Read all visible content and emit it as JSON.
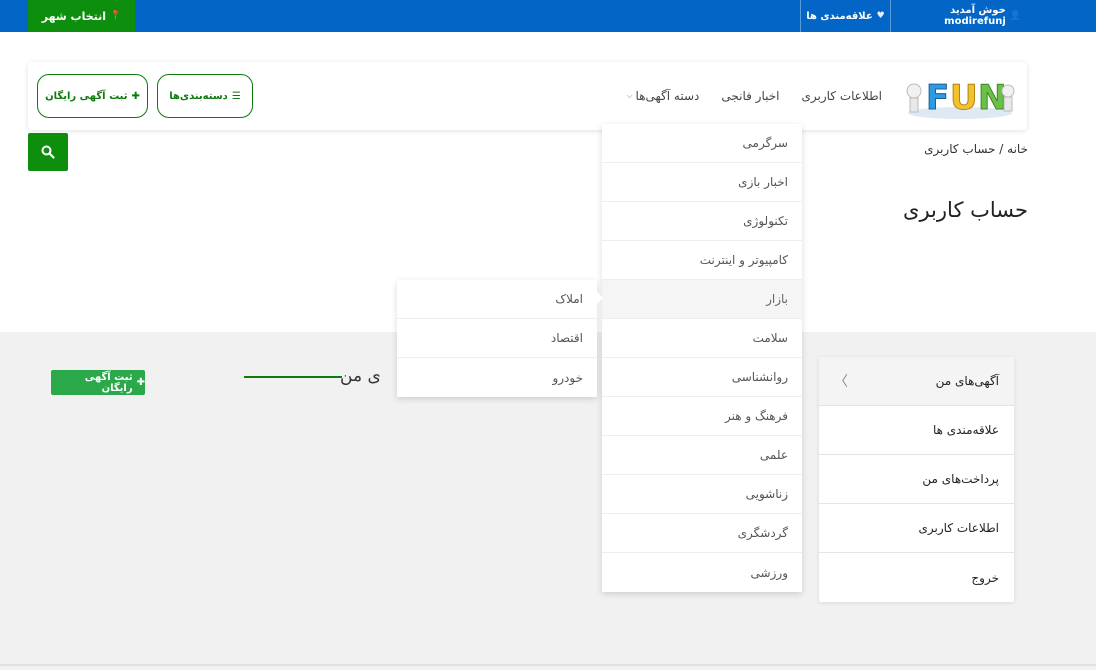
{
  "topbar": {
    "city_button": "انتخاب شهر",
    "welcome": "خوش آمدید modirefunj",
    "favorites": "علاقه‌مندی ها",
    "bg_color": "#0366c6",
    "accent_color": "#0d8f0d"
  },
  "nav": {
    "items": [
      {
        "label": "دسته آگهی‌ها",
        "has_caret": true
      },
      {
        "label": "اخبار فانجی"
      },
      {
        "label": "اطلاعات کاربری"
      }
    ],
    "categories_button": "دسته‌بندی‌ها",
    "post_ad_button": "ثبت آگهی رایگان",
    "logo_text": "FUN"
  },
  "breadcrumb": {
    "text": "خانه / حساب کاربری"
  },
  "page_title": "حساب کاربری",
  "side_menu": {
    "items": [
      {
        "label": "آگهی‌های من",
        "active": true
      },
      {
        "label": "علاقه‌مندی ها"
      },
      {
        "label": "پرداخت‌های من"
      },
      {
        "label": "اطلاعات کاربری"
      },
      {
        "label": "خروج"
      }
    ]
  },
  "content": {
    "section_title": "ی من",
    "post_ad_small": "ثبت آگهی رایگان"
  },
  "dropdown": {
    "items": [
      {
        "label": "سرگرمی"
      },
      {
        "label": "اخبار بازی"
      },
      {
        "label": "تکنولوژی"
      },
      {
        "label": "کامپیوتر و اینترنت"
      },
      {
        "label": "بازار"
      },
      {
        "label": "سلامت"
      },
      {
        "label": "روانشناسی"
      },
      {
        "label": "فرهنگ و هنر"
      },
      {
        "label": "علمی"
      },
      {
        "label": "زناشویی"
      },
      {
        "label": "گردشگری"
      },
      {
        "label": "ورزشی"
      }
    ],
    "hovered_index": 4
  },
  "submenu": {
    "items": [
      {
        "label": "املاک"
      },
      {
        "label": "اقتصاد"
      },
      {
        "label": "خودرو"
      }
    ]
  }
}
